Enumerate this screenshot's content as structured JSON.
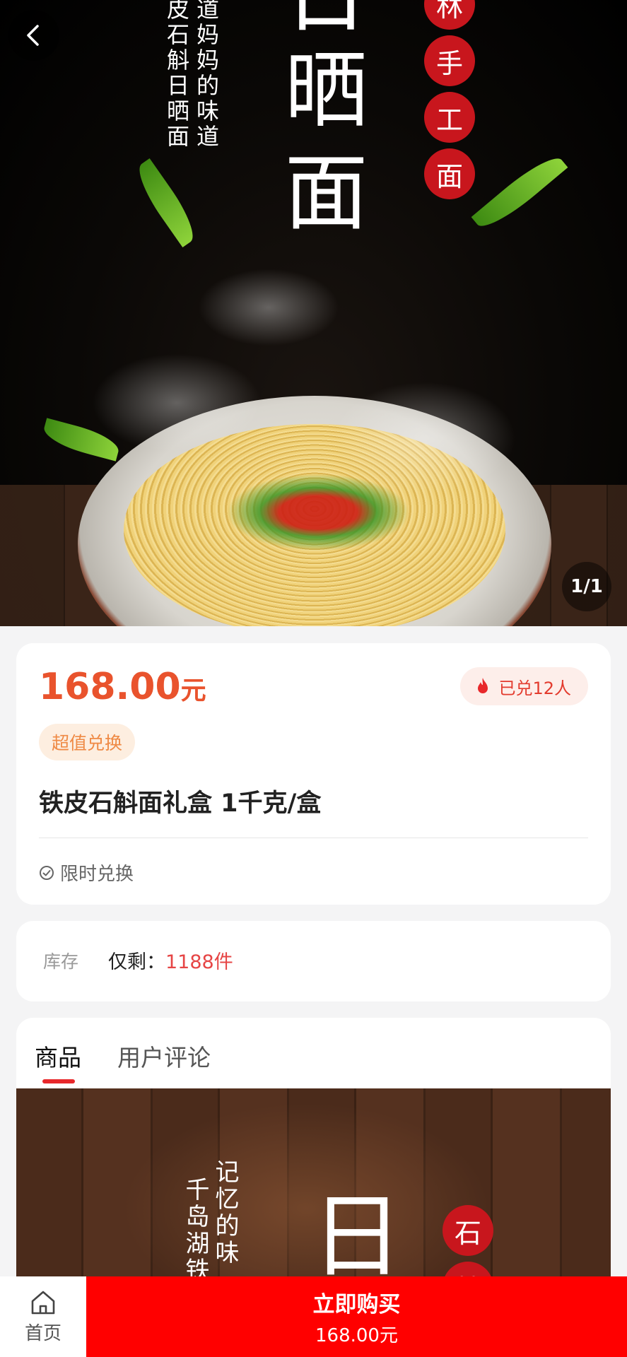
{
  "hero": {
    "counter": "1/1",
    "big_title": [
      "日",
      "晒",
      "面"
    ],
    "side_text_col1": "道妈妈的味道",
    "side_text_col2": "皮石斛日晒面",
    "seals": [
      "林",
      "手",
      "工",
      "面"
    ]
  },
  "product": {
    "price": "168.00",
    "price_unit": "元",
    "exchanged": "已兑12人",
    "tag": "超值兑换",
    "title": "铁皮石斛面礼盒 1千克/盒",
    "limited": "限时兑换"
  },
  "stock": {
    "label": "库存",
    "prefix": "仅剩：",
    "value": "1188件"
  },
  "tabs": [
    {
      "label": "商品",
      "active": true
    },
    {
      "label": "用户评论",
      "active": false
    }
  ],
  "detail_image": {
    "col1": "记忆的味",
    "col2": "千岛湖铁",
    "big_char": "日",
    "seal": "石",
    "seal2": "林"
  },
  "bottom_bar": {
    "home_label": "首页",
    "buy_label": "立即购买",
    "buy_price": "168.00元"
  },
  "colors": {
    "price": "#e9532d",
    "buy_button": "#ff0000",
    "tab_indicator": "#e8282b",
    "seal_red": "#c8161d"
  }
}
